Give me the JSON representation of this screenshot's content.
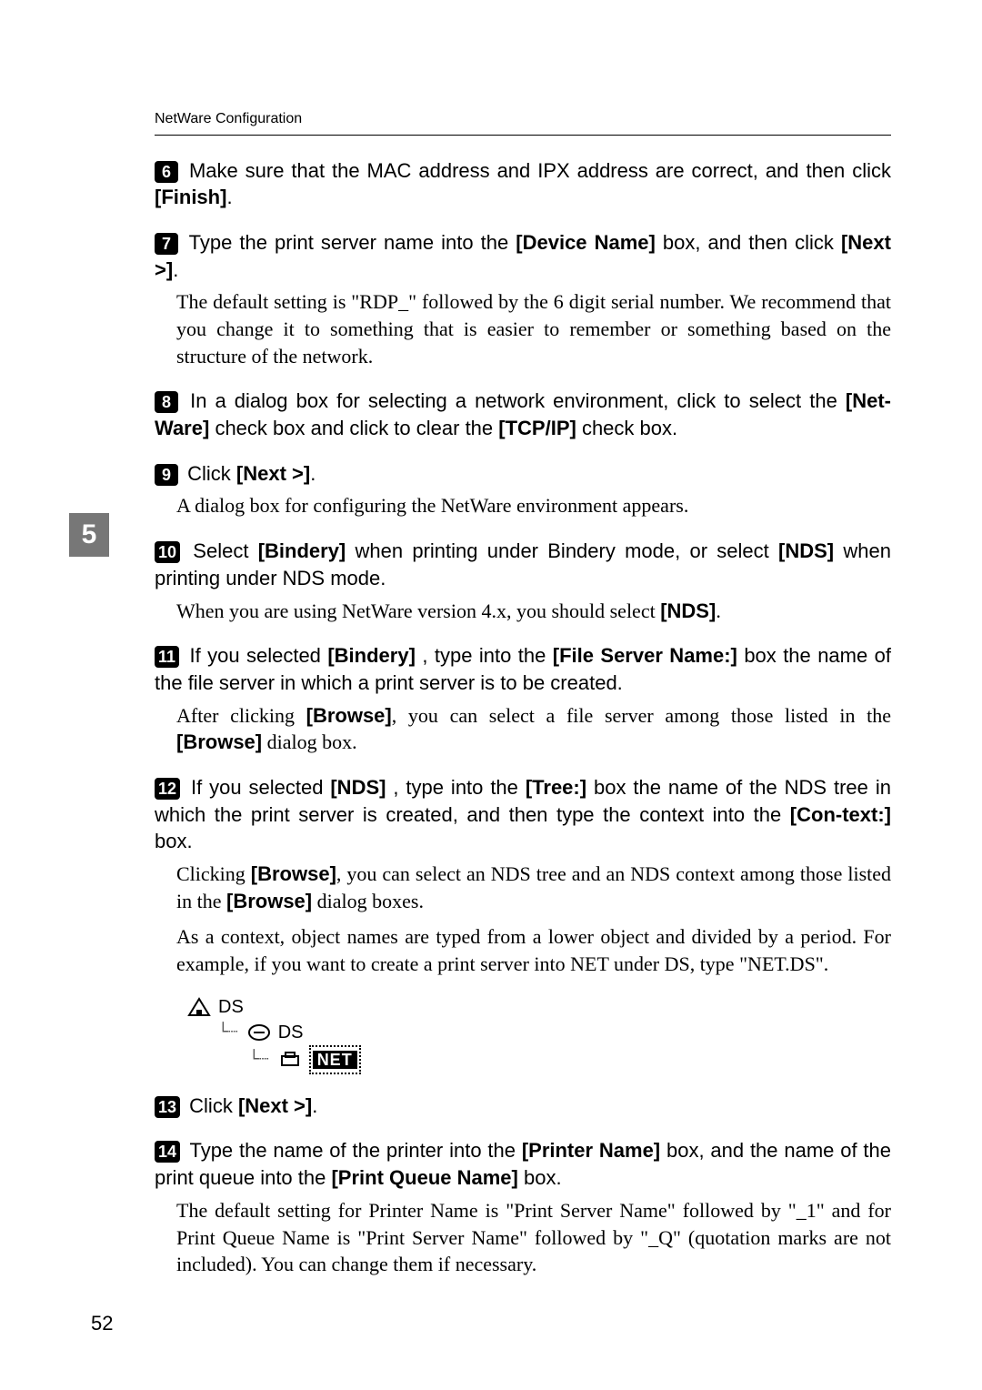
{
  "header": {
    "running_head": "NetWare Configuration"
  },
  "side_tab": "5",
  "page_number": "52",
  "steps": {
    "6": {
      "num": "6",
      "lead": "Make sure that the MAC address and IPX address are correct, and then click ",
      "kw1": "[Finish]",
      "tail": "."
    },
    "7": {
      "num": "7",
      "lead": "Type the print server name into the ",
      "kw1": "[Device Name]",
      "mid1": " box, and then click ",
      "kw2": "[Next >]",
      "tail": ".",
      "body": "The default setting is \"RDP_\" followed by the 6 digit serial number. We recommend that you change it to something that is easier to remember or something based on the structure of the network."
    },
    "8": {
      "num": "8",
      "lead": "In a dialog box for selecting a network environment, click to select the ",
      "kw1": "[Net-Ware]",
      "mid1": " check box and click to clear the ",
      "kw2": "[TCP/IP]",
      "tail": " check box."
    },
    "9": {
      "num": "9",
      "lead": "Click ",
      "kw1": "[Next >]",
      "tail": ".",
      "body": "A dialog box for configuring the NetWare environment appears."
    },
    "10": {
      "num": "10",
      "lead": "Select ",
      "kw1": "[Bindery]",
      "mid1": " when printing under Bindery mode, or select ",
      "kw2": "[NDS]",
      "tail": " when printing under NDS mode.",
      "body_a": "When you are using NetWare version 4.x, you should select ",
      "body_kw": "[NDS]",
      "body_b": "."
    },
    "11": {
      "num": "11",
      "lead": "If you selected ",
      "kw1": "[Bindery]",
      "mid1": ", type into the ",
      "kw2": "[File Server Name:]",
      "tail": " box the name of the file server in which a print server is to be created.",
      "body_a": "After clicking ",
      "body_kw1": "[Browse]",
      "body_b": ", you can select a file server among those listed in the ",
      "body_kw2": "[Browse]",
      "body_c": " dialog box."
    },
    "12": {
      "num": "12",
      "lead": "If you selected ",
      "kw1": "[NDS]",
      "mid1": ", type into the ",
      "kw2": "[Tree:]",
      "mid2": " box the name of the NDS tree in which the print server is created, and then type the context into the ",
      "kw3": "[Con-text:]",
      "tail": " box.",
      "body1_a": "Clicking ",
      "body1_kw1": "[Browse]",
      "body1_b": ", you can select an NDS tree and an NDS context among those listed in the ",
      "body1_kw2": "[Browse]",
      "body1_c": " dialog boxes.",
      "body2": "As a context, object names are typed from a lower object and divided by a period. For example, if you want to create a print server into NET under DS, type \"NET.DS\"."
    },
    "13": {
      "num": "13",
      "lead": "Click ",
      "kw1": "[Next >]",
      "tail": "."
    },
    "14": {
      "num": "14",
      "lead": "Type the name of the printer into the ",
      "kw1": "[Printer Name]",
      "mid1": " box, and the name of the print queue into the ",
      "kw2": "[Print Queue Name]",
      "tail": " box.",
      "body": "The default setting for Printer Name is \"Print Server Name\" followed by \"_1\" and for Print Queue Name is \"Print Server Name\" followed by \"_Q\" (quotation marks are not included). You can change them if necessary."
    }
  },
  "tree": {
    "node1": "DS",
    "node2": "DS",
    "node3": "NET"
  }
}
